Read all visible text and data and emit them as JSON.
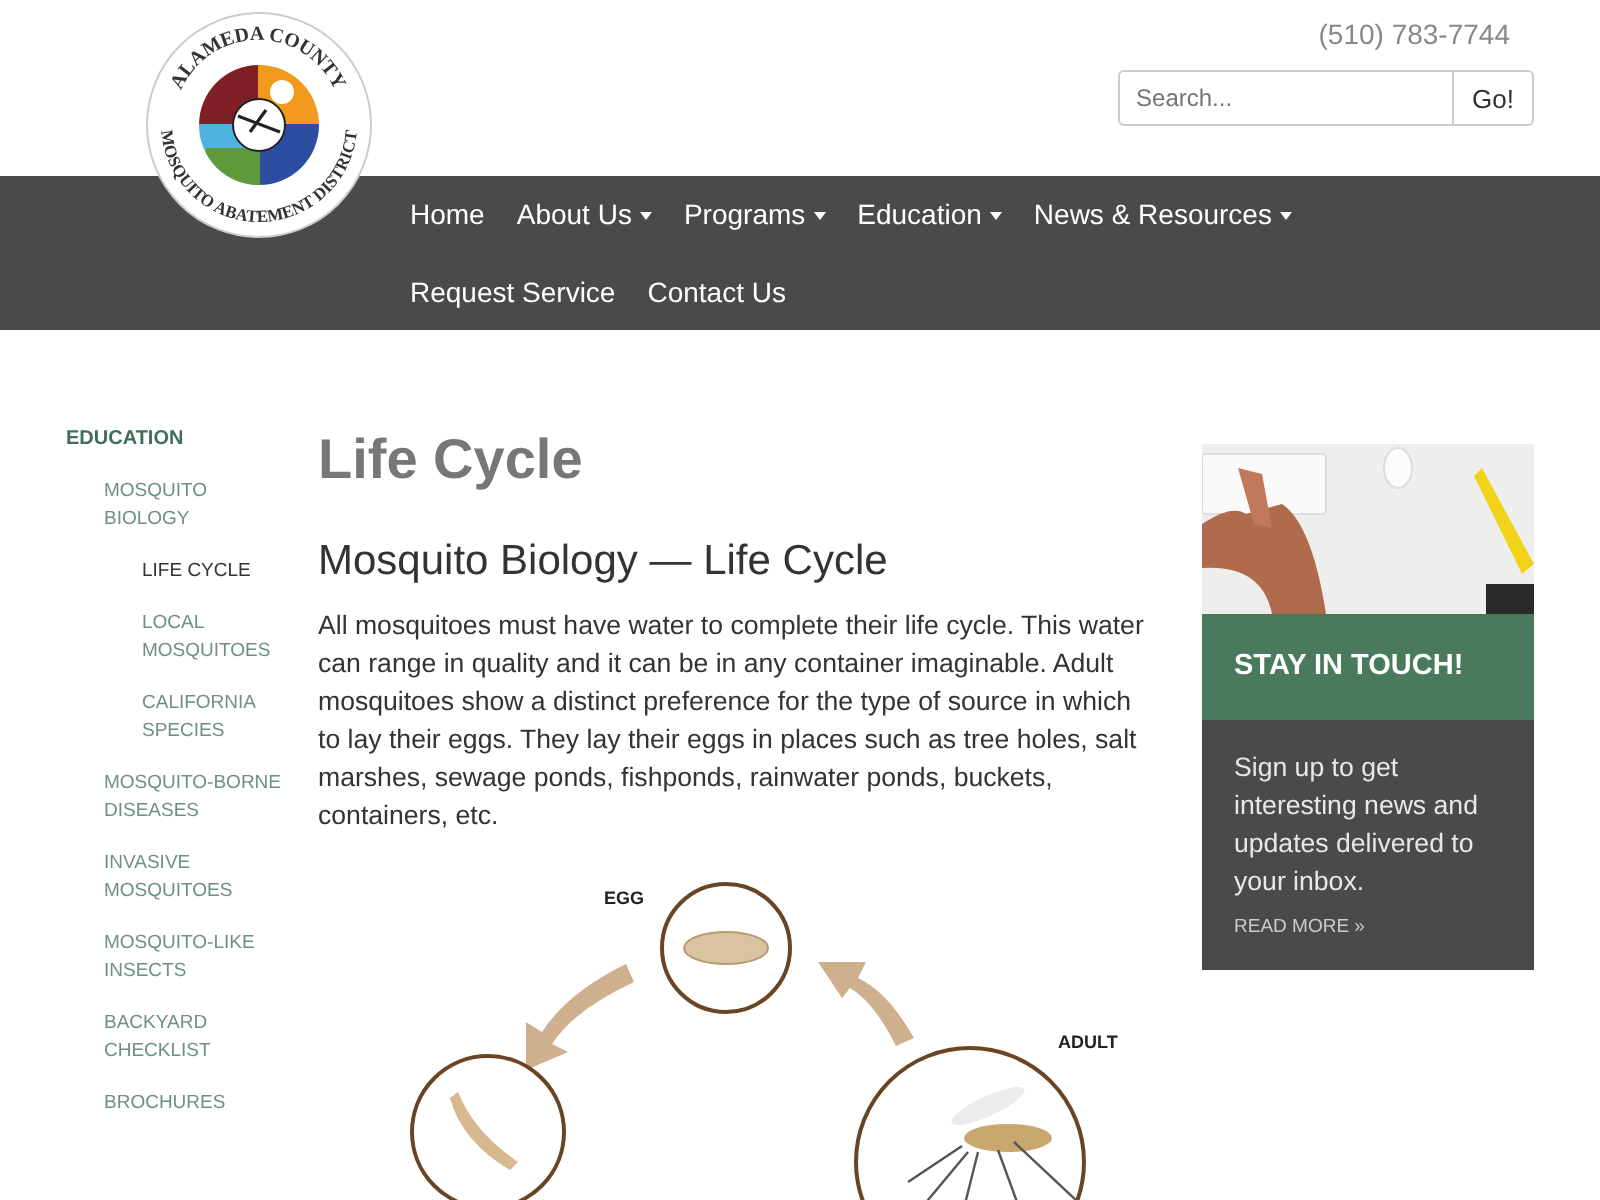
{
  "logo": {
    "top_text": "ALAMEDA COUNTY",
    "bottom_text": "MOSQUITO ABATEMENT DISTRICT"
  },
  "header": {
    "phone": "(510) 783-7744",
    "search": {
      "placeholder": "Search...",
      "button": "Go!"
    }
  },
  "nav": [
    {
      "label": "Home",
      "dropdown": false
    },
    {
      "label": "About Us",
      "dropdown": true
    },
    {
      "label": "Programs",
      "dropdown": true
    },
    {
      "label": "Education",
      "dropdown": true
    },
    {
      "label": "News & Resources",
      "dropdown": true
    },
    {
      "label": "Request Service",
      "dropdown": false
    },
    {
      "label": "Contact Us",
      "dropdown": false
    }
  ],
  "sidebar": {
    "items": [
      {
        "label": "EDUCATION",
        "selected": false,
        "children": [
          {
            "label": "MOSQUITO BIOLOGY",
            "selected": false,
            "children": [
              {
                "label": "LIFE CYCLE",
                "selected": true
              },
              {
                "label": "LOCAL MOSQUITOES",
                "selected": false
              },
              {
                "label": "CALIFORNIA SPECIES",
                "selected": false
              }
            ]
          },
          {
            "label": "MOSQUITO-BORNE DISEASES",
            "selected": false
          },
          {
            "label": "INVASIVE MOSQUITOES",
            "selected": false
          },
          {
            "label": "MOSQUITO-LIKE INSECTS",
            "selected": false
          },
          {
            "label": "BACKYARD CHECKLIST",
            "selected": false
          },
          {
            "label": "BROCHURES",
            "selected": false
          }
        ]
      }
    ]
  },
  "article": {
    "title": "Life Cycle",
    "subtitle": "Mosquito Biology — Life Cycle",
    "body": "All mosquitoes must have water to complete their life cycle. This water can range in quality and it can be in any container imaginable. Adult mosquitoes show a distinct preference for the type of source in which to lay their eggs. They lay their eggs in places such as tree holes, salt marshes, sewage ponds, fishponds, rainwater ponds, buckets, containers, etc.",
    "diagram": {
      "labels": [
        {
          "kind": "egg",
          "text": "EGG"
        },
        {
          "kind": "adult",
          "text": "ADULT"
        }
      ]
    }
  },
  "signup_card": {
    "heading": "STAY IN TOUCH!",
    "text": "Sign up to get interesting news and updates delivered to your inbox.",
    "link": "READ MORE »"
  }
}
